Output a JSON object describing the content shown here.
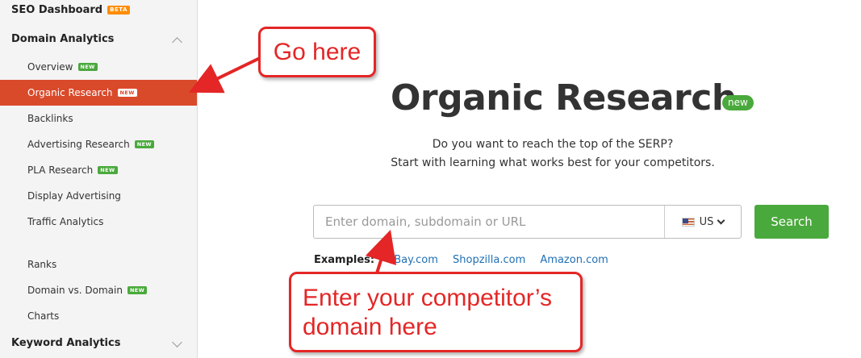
{
  "sidebar": {
    "seo_dashboard": "SEO Dashboard",
    "beta": "BETA",
    "domain_analytics": "Domain Analytics",
    "items": [
      {
        "label": "Overview",
        "badge": "NEW"
      },
      {
        "label": "Organic Research",
        "badge": "NEW"
      },
      {
        "label": "Backlinks",
        "badge": ""
      },
      {
        "label": "Advertising Research",
        "badge": "NEW"
      },
      {
        "label": "PLA Research",
        "badge": "NEW"
      },
      {
        "label": "Display Advertising",
        "badge": ""
      },
      {
        "label": "Traffic Analytics",
        "badge": ""
      },
      {
        "label": "Ranks",
        "badge": ""
      },
      {
        "label": "Domain vs. Domain",
        "badge": "NEW"
      },
      {
        "label": "Charts",
        "badge": ""
      }
    ],
    "keyword_analytics": "Keyword Analytics"
  },
  "main": {
    "title": "Organic Research",
    "title_badge": "new",
    "subtitle_line1": "Do you want to reach the top of the SERP?",
    "subtitle_line2": "Start with learning what works best for your competitors.",
    "search_placeholder": "Enter domain, subdomain or URL",
    "database": "US",
    "search_button": "Search",
    "examples_label": "Examples:",
    "examples": [
      "eBay.com",
      "Shopzilla.com",
      "Amazon.com"
    ]
  },
  "callouts": {
    "go_here": "Go here",
    "enter_domain_line1": "Enter your competitor’s",
    "enter_domain_line2": "domain here"
  },
  "colors": {
    "active": "#d94a2a",
    "green": "#4aa93c",
    "callout_red": "#e42626",
    "link": "#1f6fb5"
  }
}
